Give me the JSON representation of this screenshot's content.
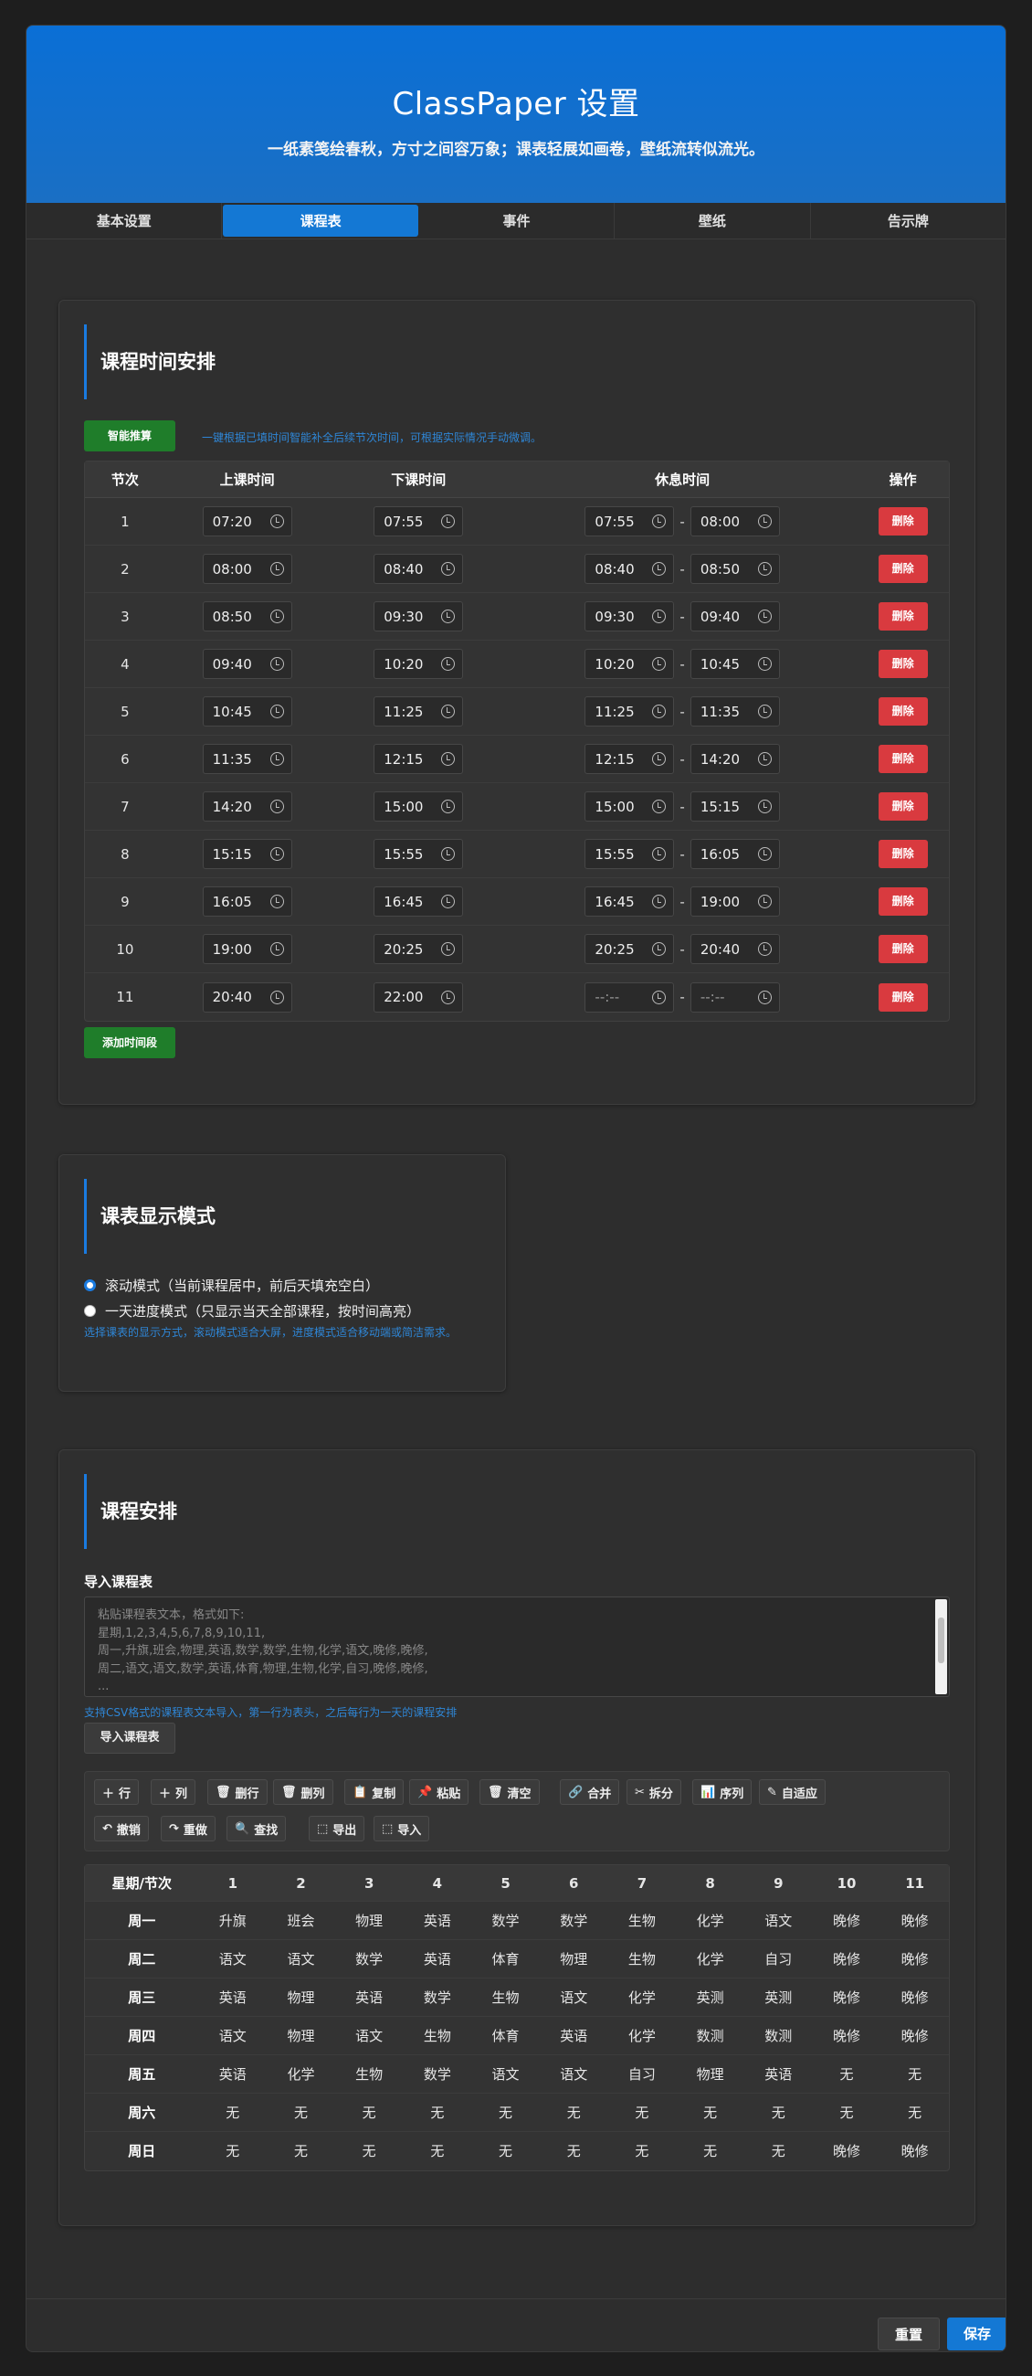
{
  "header": {
    "title": "ClassPaper 设置",
    "subtitle": "一纸素笺绘春秋，方寸之间容万象；课表轻展如画卷，壁纸流转似流光。"
  },
  "tabs": [
    {
      "label": "基本设置",
      "active": false
    },
    {
      "label": "课程表",
      "active": true
    },
    {
      "label": "事件",
      "active": false
    },
    {
      "label": "壁纸",
      "active": false
    },
    {
      "label": "告示牌",
      "active": false
    }
  ],
  "time_section": {
    "title": "课程时间安排",
    "smart_button": "智能推算",
    "hint": "一键根据已填时间智能补全后续节次时间，可根据实际情况手动微调。",
    "columns": [
      "节次",
      "上课时间",
      "下课时间",
      "休息时间",
      "操作"
    ],
    "delete_label": "删除",
    "add_button": "添加时间段",
    "rows": [
      {
        "idx": "1",
        "start": "07:20",
        "end": "07:55",
        "break_start": "07:55",
        "break_end": "08:00"
      },
      {
        "idx": "2",
        "start": "08:00",
        "end": "08:40",
        "break_start": "08:40",
        "break_end": "08:50"
      },
      {
        "idx": "3",
        "start": "08:50",
        "end": "09:30",
        "break_start": "09:30",
        "break_end": "09:40"
      },
      {
        "idx": "4",
        "start": "09:40",
        "end": "10:20",
        "break_start": "10:20",
        "break_end": "10:45"
      },
      {
        "idx": "5",
        "start": "10:45",
        "end": "11:25",
        "break_start": "11:25",
        "break_end": "11:35"
      },
      {
        "idx": "6",
        "start": "11:35",
        "end": "12:15",
        "break_start": "12:15",
        "break_end": "14:20"
      },
      {
        "idx": "7",
        "start": "14:20",
        "end": "15:00",
        "break_start": "15:00",
        "break_end": "15:15"
      },
      {
        "idx": "8",
        "start": "15:15",
        "end": "15:55",
        "break_start": "15:55",
        "break_end": "16:05"
      },
      {
        "idx": "9",
        "start": "16:05",
        "end": "16:45",
        "break_start": "16:45",
        "break_end": "19:00"
      },
      {
        "idx": "10",
        "start": "19:00",
        "end": "20:25",
        "break_start": "20:25",
        "break_end": "20:40"
      },
      {
        "idx": "11",
        "start": "20:40",
        "end": "22:00",
        "break_start": "--:--",
        "break_end": "--:--"
      }
    ]
  },
  "display_section": {
    "title": "课表显示模式",
    "options": [
      {
        "label": "滚动模式（当前课程居中，前后天填充空白）",
        "checked": true
      },
      {
        "label": "一天进度模式（只显示当天全部课程，按时间高亮）",
        "checked": false
      }
    ],
    "hint": "选择课表的显示方式，滚动模式适合大屏，进度模式适合移动端或简洁需求。"
  },
  "schedule_section": {
    "title": "课程安排",
    "import_label": "导入课程表",
    "textarea_placeholder": "粘贴课程表文本，格式如下:\n星期,1,2,3,4,5,6,7,8,9,10,11,\n周一,升旗,班会,物理,英语,数学,数学,生物,化学,语文,晚修,晚修,\n周二,语文,语文,数学,英语,体育,物理,生物,化学,自习,晚修,晚修,\n...",
    "import_hint": "支持CSV格式的课程表文本导入，第一行为表头，之后每行为一天的课程安排",
    "import_button": "导入课程表",
    "toolbar_row1": [
      {
        "icon": "plus-icon",
        "glyph": "＋",
        "label": "行"
      },
      {
        "icon": "plus-icon",
        "glyph": "＋",
        "label": "列"
      },
      {
        "icon": "trash-icon",
        "glyph": "🗑",
        "label": "删行"
      },
      {
        "icon": "trash-icon",
        "glyph": "🗑",
        "label": "删列"
      },
      {
        "icon": "copy-icon",
        "glyph": "📋",
        "label": "复制"
      },
      {
        "icon": "pin-icon",
        "glyph": "📌",
        "label": "粘贴"
      },
      {
        "icon": "trash-icon",
        "glyph": "🗑",
        "label": "清空"
      },
      {
        "icon": "link-icon",
        "glyph": "🔗",
        "label": "合并"
      },
      {
        "icon": "scissors-icon",
        "glyph": "✂",
        "label": "拆分"
      },
      {
        "icon": "chart-icon",
        "glyph": "📊",
        "label": "序列"
      },
      {
        "icon": "pencil-icon",
        "glyph": "✎",
        "label": "自适应"
      }
    ],
    "toolbar_row2": [
      {
        "icon": "undo-icon",
        "glyph": "↶",
        "label": "撤销"
      },
      {
        "icon": "redo-icon",
        "glyph": "↷",
        "label": "重做"
      },
      {
        "icon": "search-icon",
        "glyph": "🔍",
        "label": "查找"
      },
      {
        "icon": "export-icon",
        "glyph": "⬚",
        "label": "导出"
      },
      {
        "icon": "import-icon",
        "glyph": "⬚",
        "label": "导入"
      }
    ],
    "table_header": [
      "星期/节次",
      "1",
      "2",
      "3",
      "4",
      "5",
      "6",
      "7",
      "8",
      "9",
      "10",
      "11"
    ],
    "table_rows": [
      {
        "day": "周一",
        "cells": [
          "升旗",
          "班会",
          "物理",
          "英语",
          "数学",
          "数学",
          "生物",
          "化学",
          "语文",
          "晚修",
          "晚修"
        ]
      },
      {
        "day": "周二",
        "cells": [
          "语文",
          "语文",
          "数学",
          "英语",
          "体育",
          "物理",
          "生物",
          "化学",
          "自习",
          "晚修",
          "晚修"
        ]
      },
      {
        "day": "周三",
        "cells": [
          "英语",
          "物理",
          "英语",
          "数学",
          "生物",
          "语文",
          "化学",
          "英测",
          "英测",
          "晚修",
          "晚修"
        ]
      },
      {
        "day": "周四",
        "cells": [
          "语文",
          "物理",
          "语文",
          "生物",
          "体育",
          "英语",
          "化学",
          "数测",
          "数测",
          "晚修",
          "晚修"
        ]
      },
      {
        "day": "周五",
        "cells": [
          "英语",
          "化学",
          "生物",
          "数学",
          "语文",
          "语文",
          "自习",
          "物理",
          "英语",
          "无",
          "无"
        ]
      },
      {
        "day": "周六",
        "cells": [
          "无",
          "无",
          "无",
          "无",
          "无",
          "无",
          "无",
          "无",
          "无",
          "无",
          "无"
        ]
      },
      {
        "day": "周日",
        "cells": [
          "无",
          "无",
          "无",
          "无",
          "无",
          "无",
          "无",
          "无",
          "无",
          "晚修",
          "晚修"
        ]
      }
    ]
  },
  "footer": {
    "reset_button": "重置",
    "save_button": "保存"
  },
  "colors": {
    "accent": "#1a7be0",
    "header_bg": "#0a6fd6",
    "green_button": "#1f7d2a",
    "delete_button": "#d93a3f"
  }
}
